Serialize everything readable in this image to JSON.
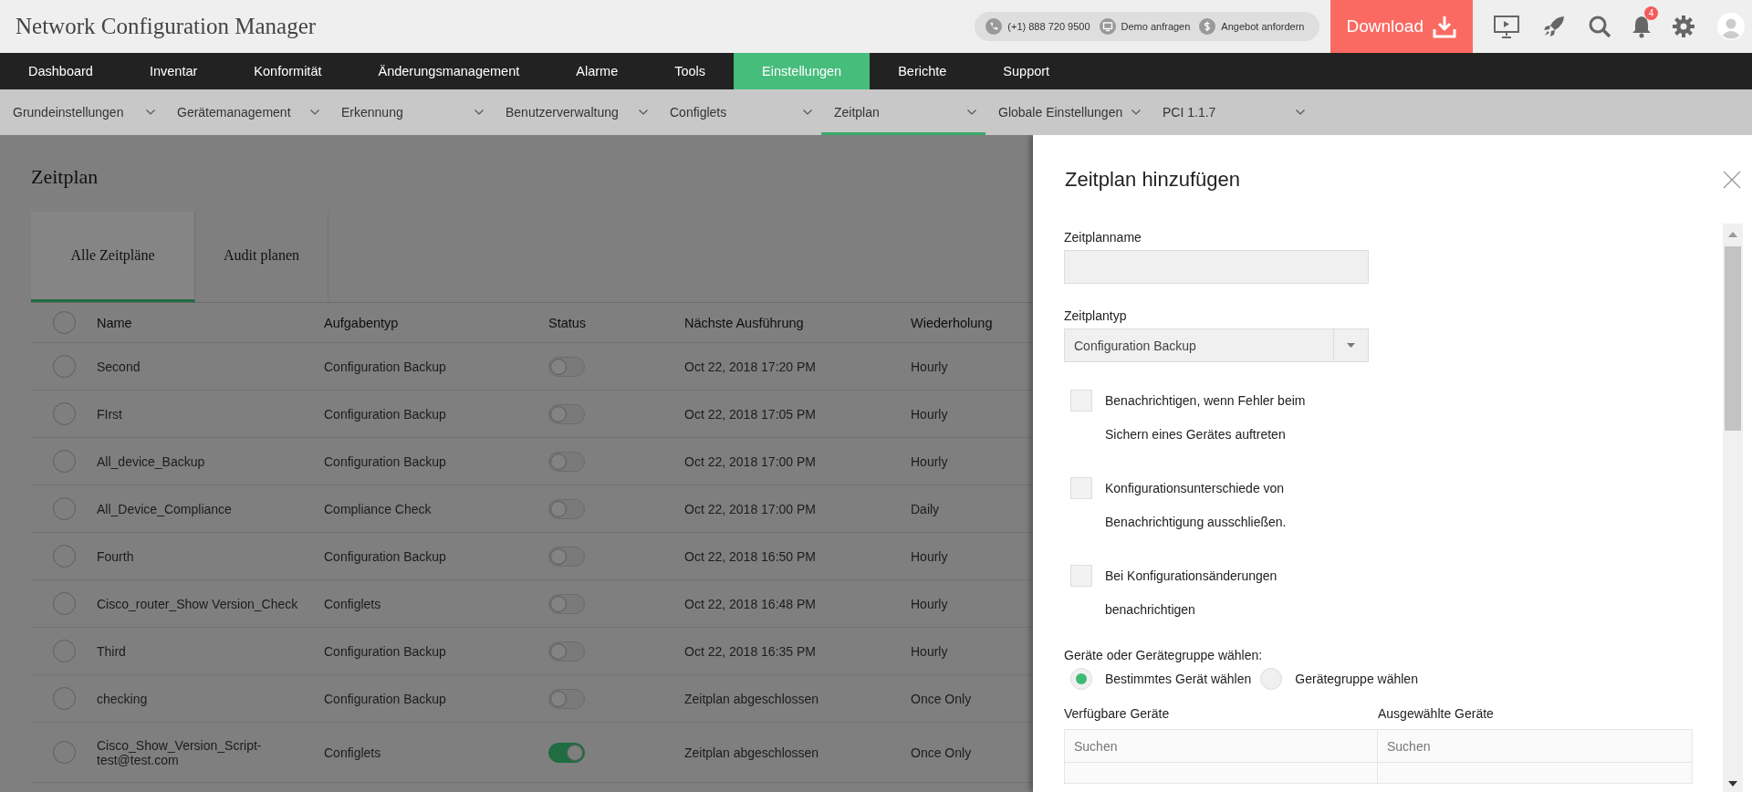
{
  "header": {
    "title": "Network Configuration Manager",
    "phone": "(+1) 888 720 9500",
    "demo_link": "Demo anfragen",
    "quote_link": "Angebot anfordern",
    "download_button": "Download",
    "notification_count": "4"
  },
  "nav": [
    {
      "label": "Dashboard",
      "selected": false
    },
    {
      "label": "Inventar",
      "selected": false
    },
    {
      "label": "Konformität",
      "selected": false
    },
    {
      "label": "Änderungsmanagement",
      "selected": false
    },
    {
      "label": "Alarme",
      "selected": false
    },
    {
      "label": "Tools",
      "selected": false
    },
    {
      "label": "Einstellungen",
      "selected": true
    },
    {
      "label": "Berichte",
      "selected": false
    },
    {
      "label": "Support",
      "selected": false
    }
  ],
  "subnav": [
    {
      "label": "Grundeinstellungen",
      "selected": false
    },
    {
      "label": "Gerätemanagement",
      "selected": false
    },
    {
      "label": "Erkennung",
      "selected": false
    },
    {
      "label": "Benutzerverwaltung",
      "selected": false
    },
    {
      "label": "Configlets",
      "selected": false
    },
    {
      "label": "Zeitplan",
      "selected": true
    },
    {
      "label": "Globale Einstellungen",
      "selected": false
    },
    {
      "label": "PCI 1.1.7",
      "selected": false
    }
  ],
  "page": {
    "title": "Zeitplan",
    "tabs": [
      {
        "label": "Alle Zeitpläne",
        "selected": true
      },
      {
        "label": "Audit planen",
        "selected": false
      }
    ],
    "table": {
      "all_checked": false,
      "columns": [
        "Name",
        "Aufgabentyp",
        "Status",
        "Nächste Ausführung",
        "Wiederholung"
      ],
      "rows": [
        {
          "checked": false,
          "name": "Second",
          "task_type": "Configuration Backup",
          "status_on": false,
          "next_run": "Oct 22, 2018 17:20 PM",
          "repeat": "Hourly"
        },
        {
          "checked": false,
          "name": "FIrst",
          "task_type": "Configuration Backup",
          "status_on": false,
          "next_run": "Oct 22, 2018 17:05 PM",
          "repeat": "Hourly"
        },
        {
          "checked": false,
          "name": "All_device_Backup",
          "task_type": "Configuration Backup",
          "status_on": false,
          "next_run": "Oct 22, 2018 17:00 PM",
          "repeat": "Hourly"
        },
        {
          "checked": false,
          "name": "All_Device_Compliance",
          "task_type": "Compliance Check",
          "status_on": false,
          "next_run": "Oct 22, 2018 17:00 PM",
          "repeat": "Daily"
        },
        {
          "checked": false,
          "name": "Fourth",
          "task_type": "Configuration Backup",
          "status_on": false,
          "next_run": "Oct 22, 2018 16:50 PM",
          "repeat": "Hourly"
        },
        {
          "checked": false,
          "name": "Cisco_router_Show Version_Check",
          "task_type": "Configlets",
          "status_on": false,
          "next_run": "Oct 22, 2018 16:48 PM",
          "repeat": "Hourly"
        },
        {
          "checked": false,
          "name": "Third",
          "task_type": "Configuration Backup",
          "status_on": false,
          "next_run": "Oct 22, 2018 16:35 PM",
          "repeat": "Hourly"
        },
        {
          "checked": false,
          "name": "checking",
          "task_type": "Configuration Backup",
          "status_on": false,
          "next_run": "Zeitplan abgeschlossen",
          "repeat": "Once Only"
        },
        {
          "checked": false,
          "name": "Cisco_Show_Version_Script-test@test.com",
          "task_type": "Configlets",
          "status_on": true,
          "next_run": "Zeitplan abgeschlossen",
          "repeat": "Once Only"
        }
      ]
    }
  },
  "panel": {
    "title": "Zeitplan hinzufügen",
    "name_field": {
      "label": "Zeitplanname"
    },
    "type_field": {
      "label": "Zeitplantyp",
      "value": "Configuration Backup"
    },
    "checkboxes": [
      {
        "lines": [
          "Benachrichtigen, wenn Fehler beim",
          "Sichern eines Gerätes auftreten"
        ],
        "checked": false
      },
      {
        "lines": [
          "Konfigurationsunterschiede von",
          "Benachrichtigung ausschließen."
        ],
        "checked": false
      },
      {
        "lines": [
          "Bei Konfigurationsänderungen",
          "benachrichtigen"
        ],
        "checked": false
      }
    ],
    "device_choice": {
      "label": "Geräte oder Gerätegruppe wählen:",
      "options": [
        {
          "label": "Bestimmtes Gerät wählen",
          "selected": true
        },
        {
          "label": "Gerätegruppe wählen",
          "selected": false
        }
      ]
    },
    "lists": [
      {
        "title": "Verfügbare Geräte",
        "placeholder": "Suchen"
      },
      {
        "title": "Ausgewählte Geräte",
        "placeholder": "Suchen"
      }
    ]
  }
}
